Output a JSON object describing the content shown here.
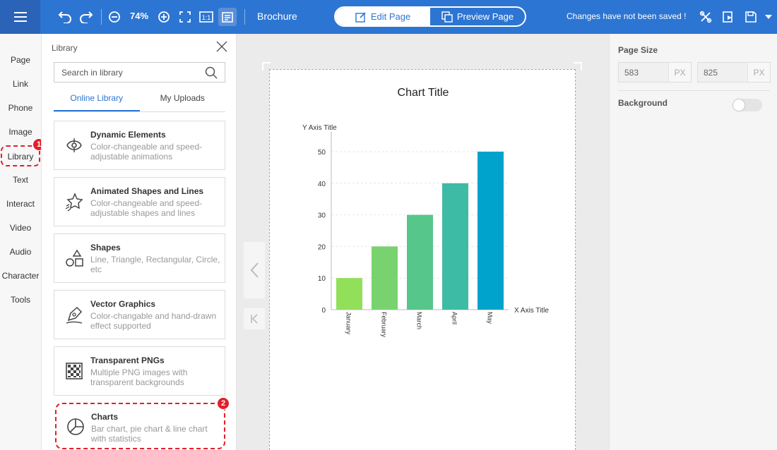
{
  "topbar": {
    "zoom": "74%",
    "doc_title": "Brochure",
    "edit_label": "Edit Page",
    "preview_label": "Preview Page",
    "save_status": "Changes have not been saved !"
  },
  "nav": {
    "items": [
      "Page",
      "Link",
      "Phone",
      "Image",
      "Library",
      "Text",
      "Interact",
      "Video",
      "Audio",
      "Character",
      "Tools"
    ],
    "badge1": "1"
  },
  "library": {
    "title": "Library",
    "search_placeholder": "Search in library",
    "tabs": [
      "Online Library",
      "My Uploads"
    ],
    "cards": [
      {
        "title": "Dynamic Elements",
        "desc": "Color-changeable and speed-adjustable animations",
        "icon": "dynamic-elements-icon"
      },
      {
        "title": "Animated Shapes and Lines",
        "desc": "Color-changeable and speed-adjustable shapes and lines",
        "icon": "animated-shapes-icon"
      },
      {
        "title": "Shapes",
        "desc": "Line, Triangle, Rectangular, Circle, etc",
        "icon": "shapes-icon"
      },
      {
        "title": "Vector Graphics",
        "desc": "Color-changable and hand-drawn effect supported",
        "icon": "vector-graphics-icon"
      },
      {
        "title": "Transparent PNGs",
        "desc": "Multiple PNG images with transparent backgrounds",
        "icon": "transparent-png-icon"
      },
      {
        "title": "Charts",
        "desc": "Bar chart, pie chart & line chart with statistics",
        "icon": "pie-chart-icon"
      }
    ],
    "badge2": "2"
  },
  "right_panel": {
    "page_size_label": "Page Size",
    "width": "583",
    "height": "825",
    "unit": "PX",
    "background_label": "Background",
    "background_on": false
  },
  "chart_data": {
    "type": "bar",
    "title": "Chart Title",
    "xlabel": "X Axis Title",
    "ylabel": "Y Axis Title",
    "categories": [
      "January",
      "February",
      "March",
      "April",
      "May"
    ],
    "values": [
      10,
      20,
      30,
      40,
      50
    ],
    "ylim": [
      0,
      50
    ],
    "yticks": [
      0,
      10,
      20,
      30,
      40,
      50
    ],
    "colors": [
      "#92e05a",
      "#78d36e",
      "#57c68b",
      "#3ebba4",
      "#00a3cc"
    ],
    "grid": true
  }
}
